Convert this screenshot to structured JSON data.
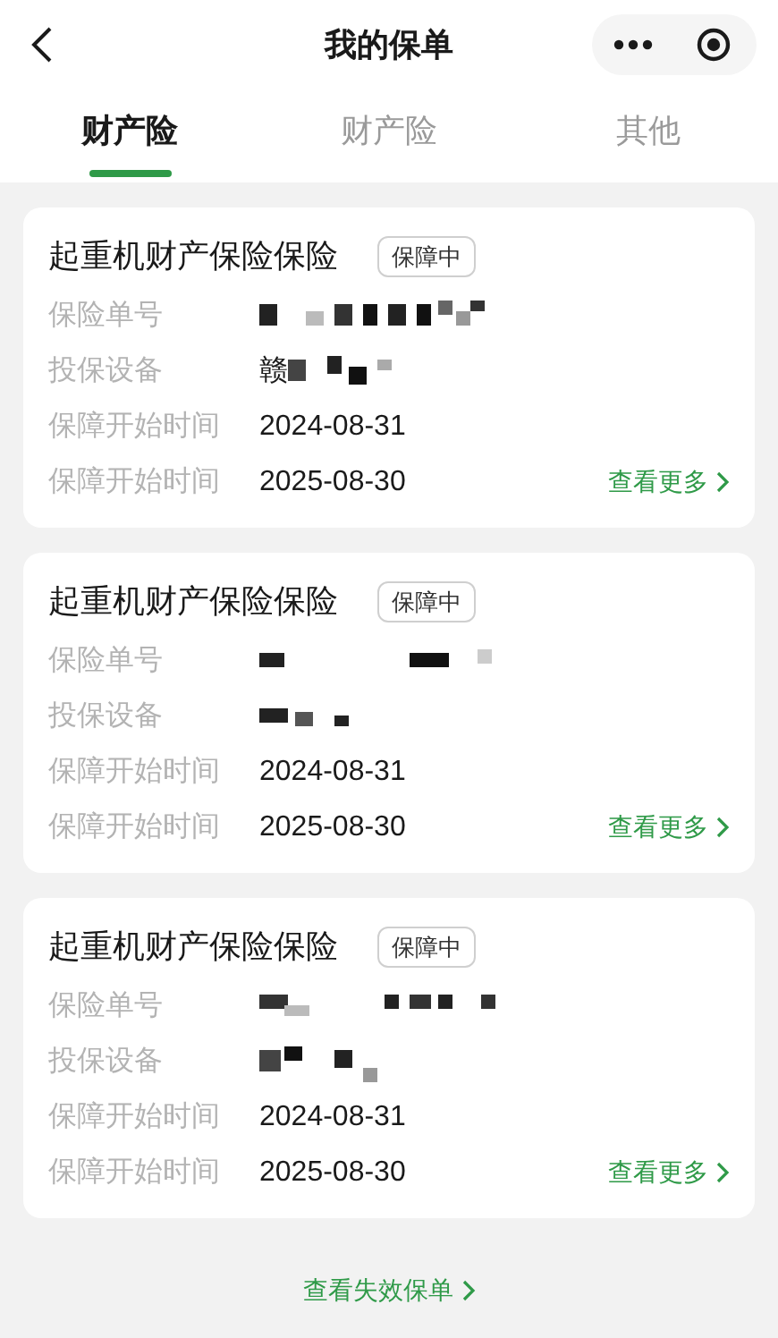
{
  "header": {
    "title": "我的保单"
  },
  "tabs": [
    {
      "label": "财产险",
      "selected": true
    },
    {
      "label": "财产险",
      "selected": false
    },
    {
      "label": "其他",
      "selected": false
    }
  ],
  "policies": [
    {
      "title": "起重机财产保险保险",
      "status": "保障中",
      "rows": [
        {
          "kind": "redacted",
          "label": "保险单号"
        },
        {
          "kind": "redacted",
          "label": "投保设备",
          "prefix": "赣"
        },
        {
          "kind": "text",
          "label": "保障开始时间",
          "value": "2024-08-31"
        },
        {
          "kind": "text",
          "label": "保障开始时间",
          "value": "2025-08-30"
        }
      ],
      "more": "查看更多"
    },
    {
      "title": "起重机财产保险保险",
      "status": "保障中",
      "rows": [
        {
          "kind": "redacted",
          "label": "保险单号"
        },
        {
          "kind": "redacted",
          "label": "投保设备"
        },
        {
          "kind": "text",
          "label": "保障开始时间",
          "value": "2024-08-31"
        },
        {
          "kind": "text",
          "label": "保障开始时间",
          "value": "2025-08-30"
        }
      ],
      "more": "查看更多"
    },
    {
      "title": "起重机财产保险保险",
      "status": "保障中",
      "rows": [
        {
          "kind": "redacted",
          "label": "保险单号"
        },
        {
          "kind": "redacted",
          "label": "投保设备"
        },
        {
          "kind": "text",
          "label": "保障开始时间",
          "value": "2024-08-31"
        },
        {
          "kind": "text",
          "label": "保障开始时间",
          "value": "2025-08-30"
        }
      ],
      "more": "查看更多"
    }
  ],
  "footer_link": "查看失效保单"
}
